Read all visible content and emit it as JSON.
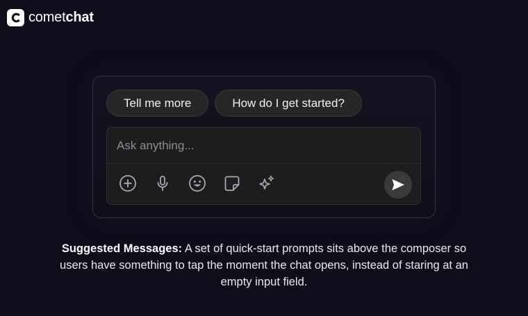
{
  "brand": {
    "name_light": "comet",
    "name_bold": "chat"
  },
  "suggestions": [
    {
      "label": "Tell me more"
    },
    {
      "label": "How do I get started?"
    }
  ],
  "composer": {
    "placeholder": "Ask anything...",
    "tools": [
      "add-icon",
      "microphone-icon",
      "emoji-icon",
      "sticker-icon",
      "ai-sparkle-icon"
    ],
    "send_icon": "send-icon"
  },
  "caption": {
    "title": "Suggested Messages:",
    "body": "A set of quick-start prompts sits above the composer so users have something to tap the moment the chat opens, instead of staring at an empty input field."
  },
  "colors": {
    "background": "#0f0d19",
    "chip": "#262626",
    "composer": "#1d1d1f",
    "send": "#3a3a3c"
  }
}
